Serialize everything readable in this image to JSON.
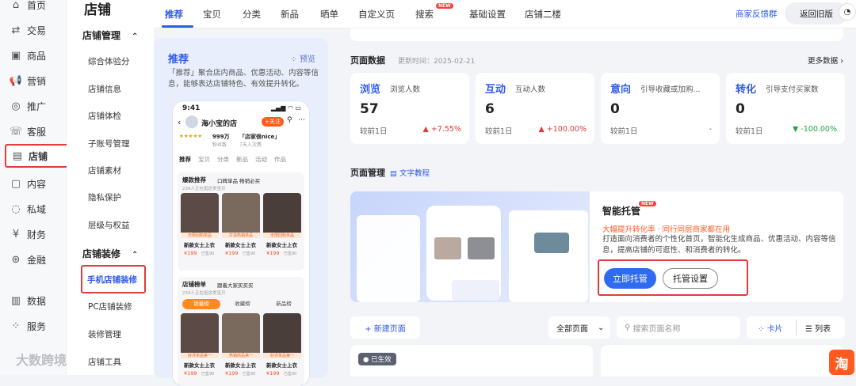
{
  "nav1": {
    "items": [
      {
        "icon": "home-icon",
        "glyph": "⌂",
        "label": "首页"
      },
      {
        "icon": "exchange-icon",
        "glyph": "⇄",
        "label": "交易"
      },
      {
        "icon": "goods-icon",
        "glyph": "▣",
        "label": "商品"
      },
      {
        "icon": "megaphone-icon",
        "glyph": "📢",
        "label": "营销"
      },
      {
        "icon": "promote-icon",
        "glyph": "◎",
        "label": "推广"
      },
      {
        "icon": "service-icon",
        "glyph": "☏",
        "label": "客服"
      },
      {
        "icon": "store-icon",
        "glyph": "▤",
        "label": "店铺"
      },
      {
        "icon": "content-icon",
        "glyph": "▢",
        "label": "内容"
      },
      {
        "icon": "private-icon",
        "glyph": "◌",
        "label": "私域"
      },
      {
        "icon": "finance-icon",
        "glyph": "¥",
        "label": "财务"
      },
      {
        "icon": "money-icon",
        "glyph": "⊛",
        "label": "金融"
      },
      {
        "icon": "data-icon",
        "glyph": "▥",
        "label": "数据"
      },
      {
        "icon": "service-grid-icon",
        "glyph": "⁘",
        "label": "服务"
      }
    ]
  },
  "nav2": {
    "title": "店铺",
    "group1": "店铺管理",
    "links1": [
      "综合体验分",
      "店铺信息",
      "店铺体检",
      "子账号管理",
      "店铺素材",
      "隐私保护",
      "层级与权益"
    ],
    "group2": "店铺装修",
    "active": "手机店铺装修",
    "links2": [
      "PC店铺装修",
      "装修管理",
      "店铺工具"
    ]
  },
  "tabs": {
    "items": [
      "推荐",
      "宝贝",
      "分类",
      "新品",
      "晒单",
      "自定义页",
      "搜索",
      "基础设置",
      "店铺二楼"
    ],
    "new_badge": "NEW",
    "feedback": "商家反馈群",
    "old_version": "返回旧版"
  },
  "rec": {
    "title": "推荐",
    "preview": "预览",
    "desc": "「推荐」聚合店内商品、优惠活动、内容等信息，能够表达店铺特色、有效提升转化。",
    "phone": {
      "time": "9:41",
      "shop": "海小宝的店",
      "follow": "+关注",
      "stats": [
        "999万",
        "「店家很nice」"
      ],
      "stats_sub": [
        "粉丝数",
        "7天人次费"
      ],
      "tabs": [
        "推荐",
        "宝贝",
        "分类",
        "新品",
        "活动",
        "作品"
      ],
      "sec1": "爆款推荐",
      "sec1_sub": "口碑单品 畅销必买",
      "sec1_note": "234人正在逛这类宝贝",
      "items1": [
        {
          "tag": "无限回购单品",
          "name": "新款女士上衣",
          "price": "¥199"
        },
        {
          "tag": "打造热销单品",
          "name": "新款女士上衣",
          "price": "¥199"
        },
        {
          "tag": "无限回购单品",
          "name": "新款女士上衣",
          "price": "¥199"
        }
      ],
      "sales": "已售90",
      "sec2": "店铺榜单",
      "sec2_sub": "跟着大家买买买",
      "sec2_note": "234人正在逛这类宝贝",
      "rank_tabs": [
        "销量榜",
        "收藏榜",
        "新品榜"
      ],
      "items2": [
        {
          "tag": "好评单品第一",
          "name": "新款女士上衣",
          "price": "¥199"
        },
        {
          "tag": "热销商品第一",
          "name": "新款女士上衣",
          "price": "¥199"
        },
        {
          "tag": "好评单品第一",
          "name": "新款女士上衣",
          "price": "¥199"
        }
      ]
    }
  },
  "page_data": {
    "title": "页面数据",
    "updated": "更新时间：2025-02-21",
    "more": "更多数据",
    "cards": [
      {
        "title": "浏览",
        "sub": "浏览人数",
        "value": "57",
        "cmp": "较前1日",
        "pct": "+7.55%",
        "dir": "up",
        "color": "#e23b3b"
      },
      {
        "title": "互动",
        "sub": "互动人数",
        "value": "6",
        "cmp": "较前1日",
        "pct": "+100.00%",
        "dir": "up",
        "color": "#e23b3b"
      },
      {
        "title": "意向",
        "sub": "引导收藏或加购...",
        "value": "0",
        "cmp": "较前1日",
        "pct": "-",
        "dir": "none",
        "color": "#666"
      },
      {
        "title": "转化",
        "sub": "引导支付买家数",
        "value": "0",
        "cmp": "较前1日",
        "pct": "-100.00%",
        "dir": "down",
        "color": "#1fa64a"
      }
    ]
  },
  "mgmt": {
    "title": "页面管理",
    "tutorial": "文字教程",
    "smart_title": "智能托管",
    "new_badge": "NEW",
    "slogan": "大幅提升转化率 · 同行同层商家都在用",
    "desc": "打造面向消费者的个性化首页，智能化生成商品、优惠活动、内容等信息，提高店铺的可逛性、和消费者的转化。",
    "btn_primary": "立即托管",
    "btn_secondary": "托管设置"
  },
  "toolbar": {
    "new_page": "+ 新建页面",
    "filter": "全部页面",
    "search_placeholder": "搜索页面名称",
    "card_view": "卡片",
    "list_view": "列表",
    "active_badge": "已生效"
  },
  "watermark": "大数跨境",
  "taobao_badge": "淘"
}
